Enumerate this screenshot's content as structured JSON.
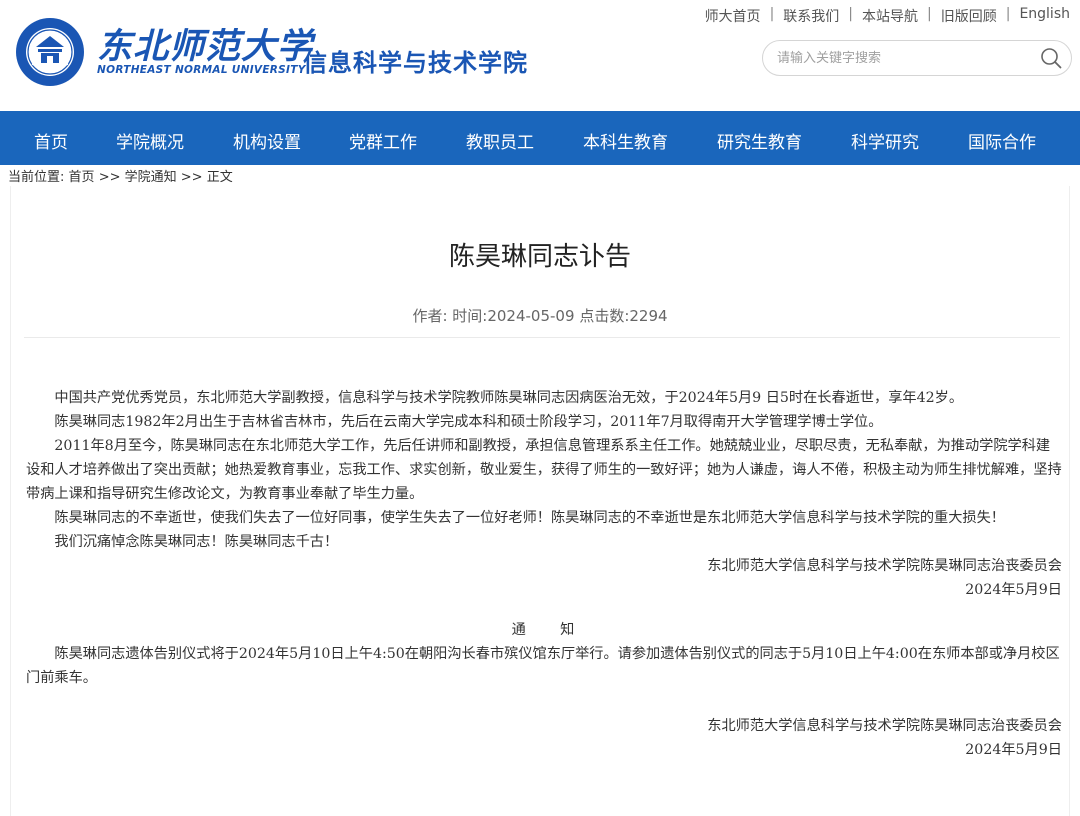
{
  "header": {
    "school_name_cn": "东北师范大学",
    "school_name_en": "NORTHEAST NORMAL UNIVERSITY",
    "college_name": "信息科学与技术学院",
    "seal_text": "NORTHEAST NORMAL UNIVERSITY",
    "top_links": [
      {
        "label": "师大首页"
      },
      {
        "label": "联系我们"
      },
      {
        "label": "本站导航"
      },
      {
        "label": "旧版回顾"
      },
      {
        "label": "English"
      }
    ],
    "search_placeholder": "请输入关键字搜索",
    "brand_color": "#1a66bc"
  },
  "nav": {
    "items": [
      {
        "label": "首页"
      },
      {
        "label": "学院概况"
      },
      {
        "label": "机构设置"
      },
      {
        "label": "党群工作"
      },
      {
        "label": "教职员工"
      },
      {
        "label": "本科生教育"
      },
      {
        "label": "研究生教育"
      },
      {
        "label": "科学研究"
      },
      {
        "label": "国际合作"
      }
    ]
  },
  "breadcrumb": {
    "prefix": "当前位置:",
    "items": [
      {
        "label": "首页"
      },
      {
        "label": "学院通知"
      },
      {
        "label": "正文"
      }
    ],
    "separator": ">>"
  },
  "article": {
    "title": "陈昊琳同志讣告",
    "author_label": "作者:",
    "time_label": "时间:",
    "date": "2024-05-09",
    "clicks_label": "点击数:",
    "clicks": "2294",
    "paragraphs": [
      "中国共产党优秀党员，东北师范大学副教授，信息科学与技术学院教师陈昊琳同志因病医治无效，于2024年5月9 日5时在长春逝世，享年42岁。",
      "陈昊琳同志1982年2月出生于吉林省吉林市，先后在云南大学完成本科和硕士阶段学习，2011年7月取得南开大学管理学博士学位。",
      "2011年8月至今，陈昊琳同志在东北师范大学工作，先后任讲师和副教授，承担信息管理系系主任工作。她兢兢业业，尽职尽责，无私奉献，为推动学院学科建设和人才培养做出了突出贡献；她热爱教育事业，忘我工作、求实创新，敬业爱生，获得了师生的一致好评；她为人谦虚，诲人不倦，积极主动为师生排忧解难，坚持带病上课和指导研究生修改论文，为教育事业奉献了毕生力量。",
      "陈昊琳同志的不幸逝世，使我们失去了一位好同事，使学生失去了一位好老师！陈昊琳同志的不幸逝世是东北师范大学信息科学与技术学院的重大损失！",
      "我们沉痛悼念陈昊琳同志！陈昊琳同志千古！"
    ],
    "signature": "东北师范大学信息科学与技术学院陈昊琳同志治丧委员会",
    "signature_date": "2024年5月9日",
    "notice_heading": "通　　知",
    "notice_text": "陈昊琳同志遗体告别仪式将于2024年5月10日上午4:50在朝阳沟长春市殡仪馆东厅举行。请参加遗体告别仪式的同志于5月10日上午4:00在东师本部或净月校区门前乘车。",
    "notice_signature": "东北师范大学信息科学与技术学院陈昊琳同志治丧委员会",
    "notice_date": "2024年5月9日"
  }
}
